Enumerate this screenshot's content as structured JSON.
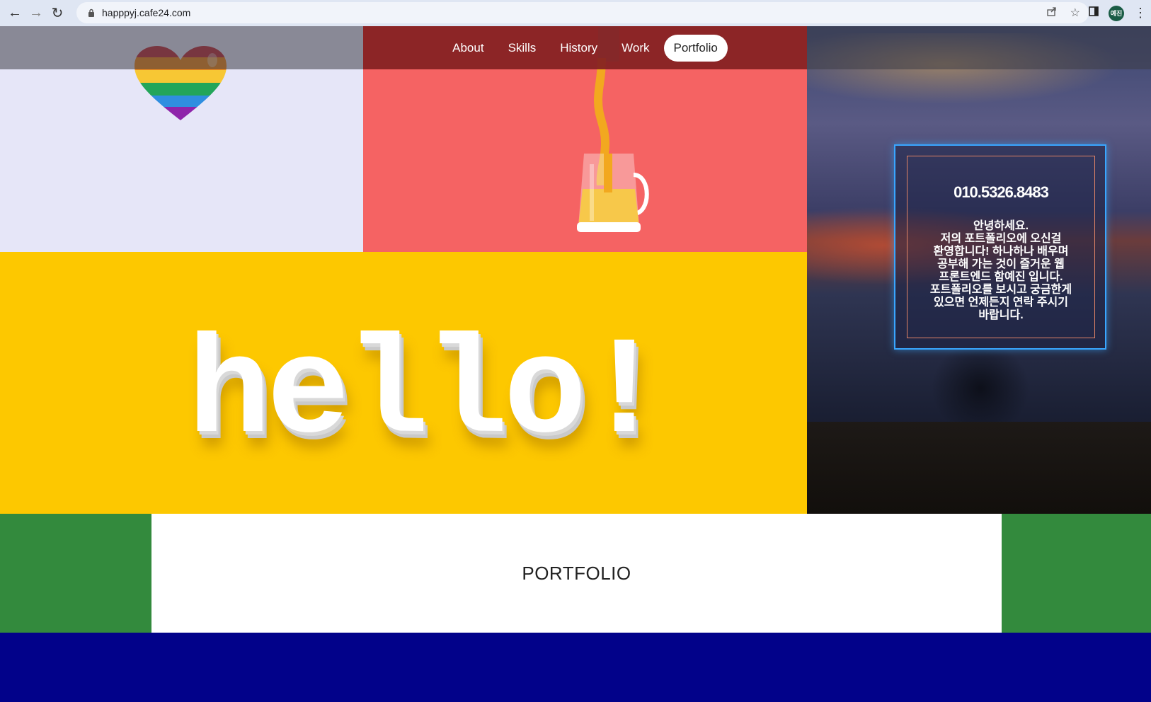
{
  "browser": {
    "url": "happpyj.cafe24.com",
    "profile_initials": "예진",
    "icons": {
      "back": "arrow-left-icon",
      "forward": "arrow-right-icon",
      "reload": "reload-icon",
      "lock": "lock-icon",
      "share": "share-icon",
      "bookmark": "star-icon",
      "sidepanel": "side-panel-icon",
      "menu": "kebab-menu-icon"
    }
  },
  "nav": {
    "items": [
      {
        "label": "About"
      },
      {
        "label": "Skills"
      },
      {
        "label": "History"
      },
      {
        "label": "Work"
      },
      {
        "label": "Portfolio",
        "active": true
      }
    ]
  },
  "hero": {
    "hello_text": "hello!"
  },
  "contact": {
    "phone": "010.5326.8483",
    "message": "안녕하세요.\n저의 포트폴리오에 오신걸 환영합니다! 하나하나 배우며 공부해 가는 것이 즐거운 웹 프론트엔드 함예진 입니다. 포트폴리오를 보시고 궁금한게 있으면 언제든지 연락 주시기 바랍니다."
  },
  "portfolio": {
    "heading": "PORTFOLIO"
  },
  "colors": {
    "lavender": "#e6e6f8",
    "coral": "#f56363",
    "yellow": "#fdc800",
    "green": "#338a3d",
    "navy": "#02028a",
    "card_border": "#39a6ff"
  }
}
